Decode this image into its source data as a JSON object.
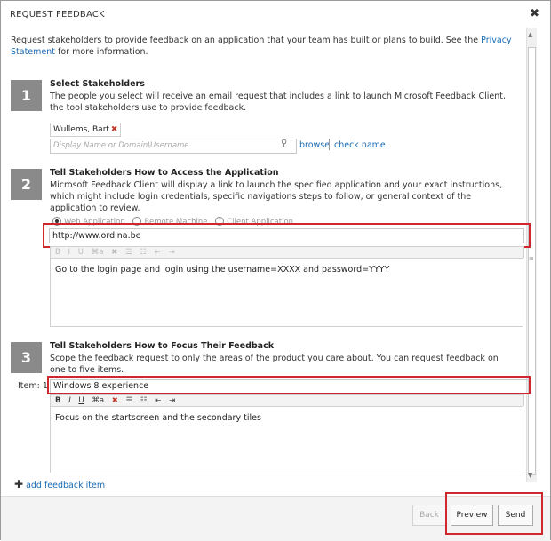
{
  "dialog": {
    "title": "REQUEST FEEDBACK",
    "close_glyph": "✖"
  },
  "intro": {
    "text": "Request stakeholders to provide feedback on an application that your team has built or plans to build. See the ",
    "link": "Privacy Statement",
    "text_after": " for more information."
  },
  "sections": [
    {
      "number": "1",
      "title": "Select Stakeholders",
      "description": "The people you select will receive an email request that includes a link to launch Microsoft Feedback Client, the tool stakeholders use to provide feedback."
    },
    {
      "number": "2",
      "title": "Tell Stakeholders How to Access the Application",
      "description": "Microsoft Feedback Client will display a link to launch the specified application and your exact instructions, which might include login credentials, specific navigations steps to follow, or general context of the application to review."
    },
    {
      "number": "3",
      "title": "Tell Stakeholders How to Focus Their Feedback",
      "description": "Scope the feedback request to only the areas of the product you care about. You can request feedback on one to five items."
    }
  ],
  "stakeholders": {
    "token": "Wullems, Bart",
    "token_remove": "✖",
    "search_placeholder": "Display Name or Domain\\Username",
    "browse": "browse",
    "check_name": "check name"
  },
  "access": {
    "options": [
      "Web Application",
      "Remote Machine",
      "Client Application"
    ],
    "selected": "Web Application",
    "url": "http://www.ordina.be",
    "instructions": "Go to the login page and login using the username=XXXX and password=YYYY"
  },
  "toolbar": {
    "bold": "B",
    "italic": "I",
    "underline": "U",
    "format": "⌘a",
    "clear": "✖",
    "bullets": "☰",
    "numbering": "☷",
    "outdent": "⇤",
    "indent": "⇥"
  },
  "focus": {
    "item_label": "Item: 1",
    "item_value": "Windows 8 experience",
    "notes": "Focus on the startscreen and the secondary tiles",
    "add_item": "add feedback item"
  },
  "buttons": {
    "back": "Back",
    "preview": "Preview",
    "send": "Send"
  },
  "colors": {
    "highlight": "#d0262d",
    "link": "#1a6bb3",
    "step_badge": "#8a8a8a"
  }
}
